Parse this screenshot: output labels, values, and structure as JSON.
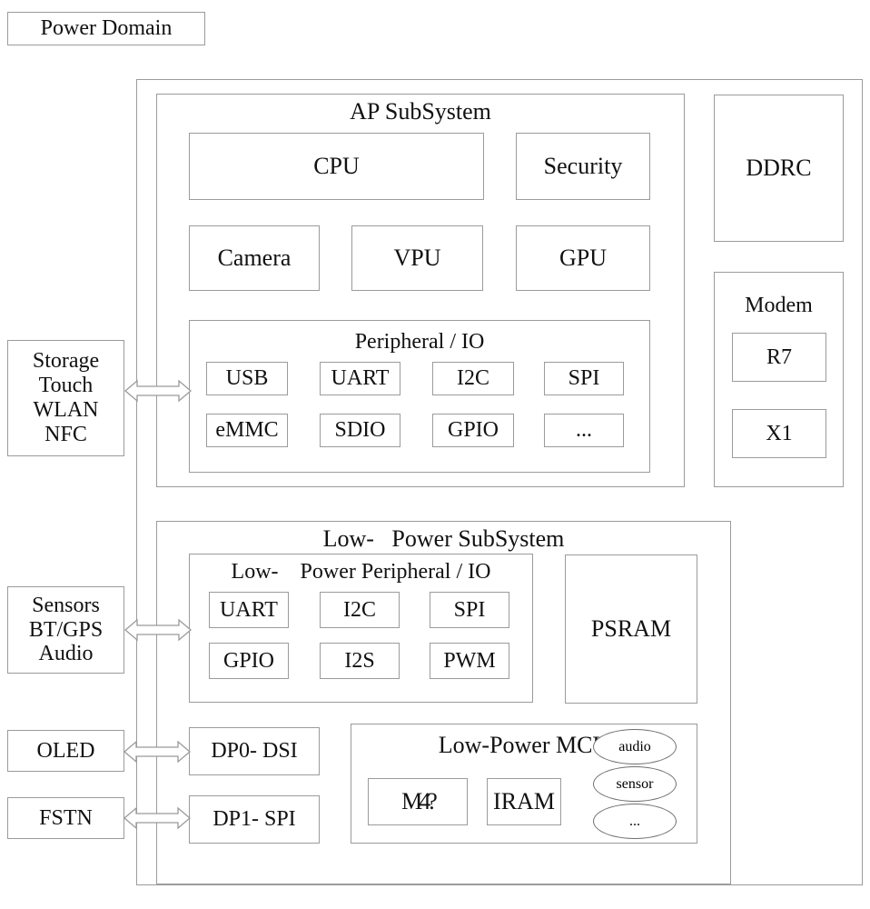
{
  "diagram": {
    "legend_label": "Power Domain",
    "ap_subsystem": {
      "title": "AP SubSystem",
      "blocks": [
        {
          "label": "CPU"
        },
        {
          "label": "Security"
        },
        {
          "label": "Camera"
        },
        {
          "label": "VPU"
        },
        {
          "label": "GPU"
        }
      ],
      "peripheral_io": {
        "title": "Peripheral / IO",
        "row1": [
          "USB",
          "UART",
          "I2C",
          "SPI"
        ],
        "row2": [
          "eMMC",
          "SDIO",
          "GPIO",
          "..."
        ]
      }
    },
    "ddrc": {
      "label": "DDRC"
    },
    "modem": {
      "title": "Modem",
      "blocks": [
        "R7",
        "X1"
      ]
    },
    "low_power_subsystem": {
      "title": "Low-   Power SubSystem",
      "peripheral_io": {
        "title": "Low-    Power Peripheral / IO",
        "row1": [
          "UART",
          "I2C",
          "SPI"
        ],
        "row2": [
          "GPIO",
          "I2S",
          "PWM"
        ]
      },
      "psram": {
        "label": "PSRAM"
      },
      "display_ports": [
        {
          "label": "DP0- DSI"
        },
        {
          "label": "DP1- SPI"
        }
      ],
      "low_power_mcu": {
        "title": "Low-Power MCU",
        "blocks": [
          "M4?",
          "IRAM"
        ],
        "bubbles": [
          "audio",
          "sensor",
          "..."
        ]
      }
    },
    "external_blocks": [
      {
        "label": "Storage\nTouch\nWLAN\nNFC"
      },
      {
        "label": "Sensors\nBT/GPS\nAudio"
      },
      {
        "label": "OLED"
      },
      {
        "label": "FSTN"
      }
    ]
  },
  "colors": {
    "stroke": "#9b9b9b",
    "text": "#111111",
    "background": "#ffffff",
    "arrow_stroke": "#9a9a9a"
  }
}
